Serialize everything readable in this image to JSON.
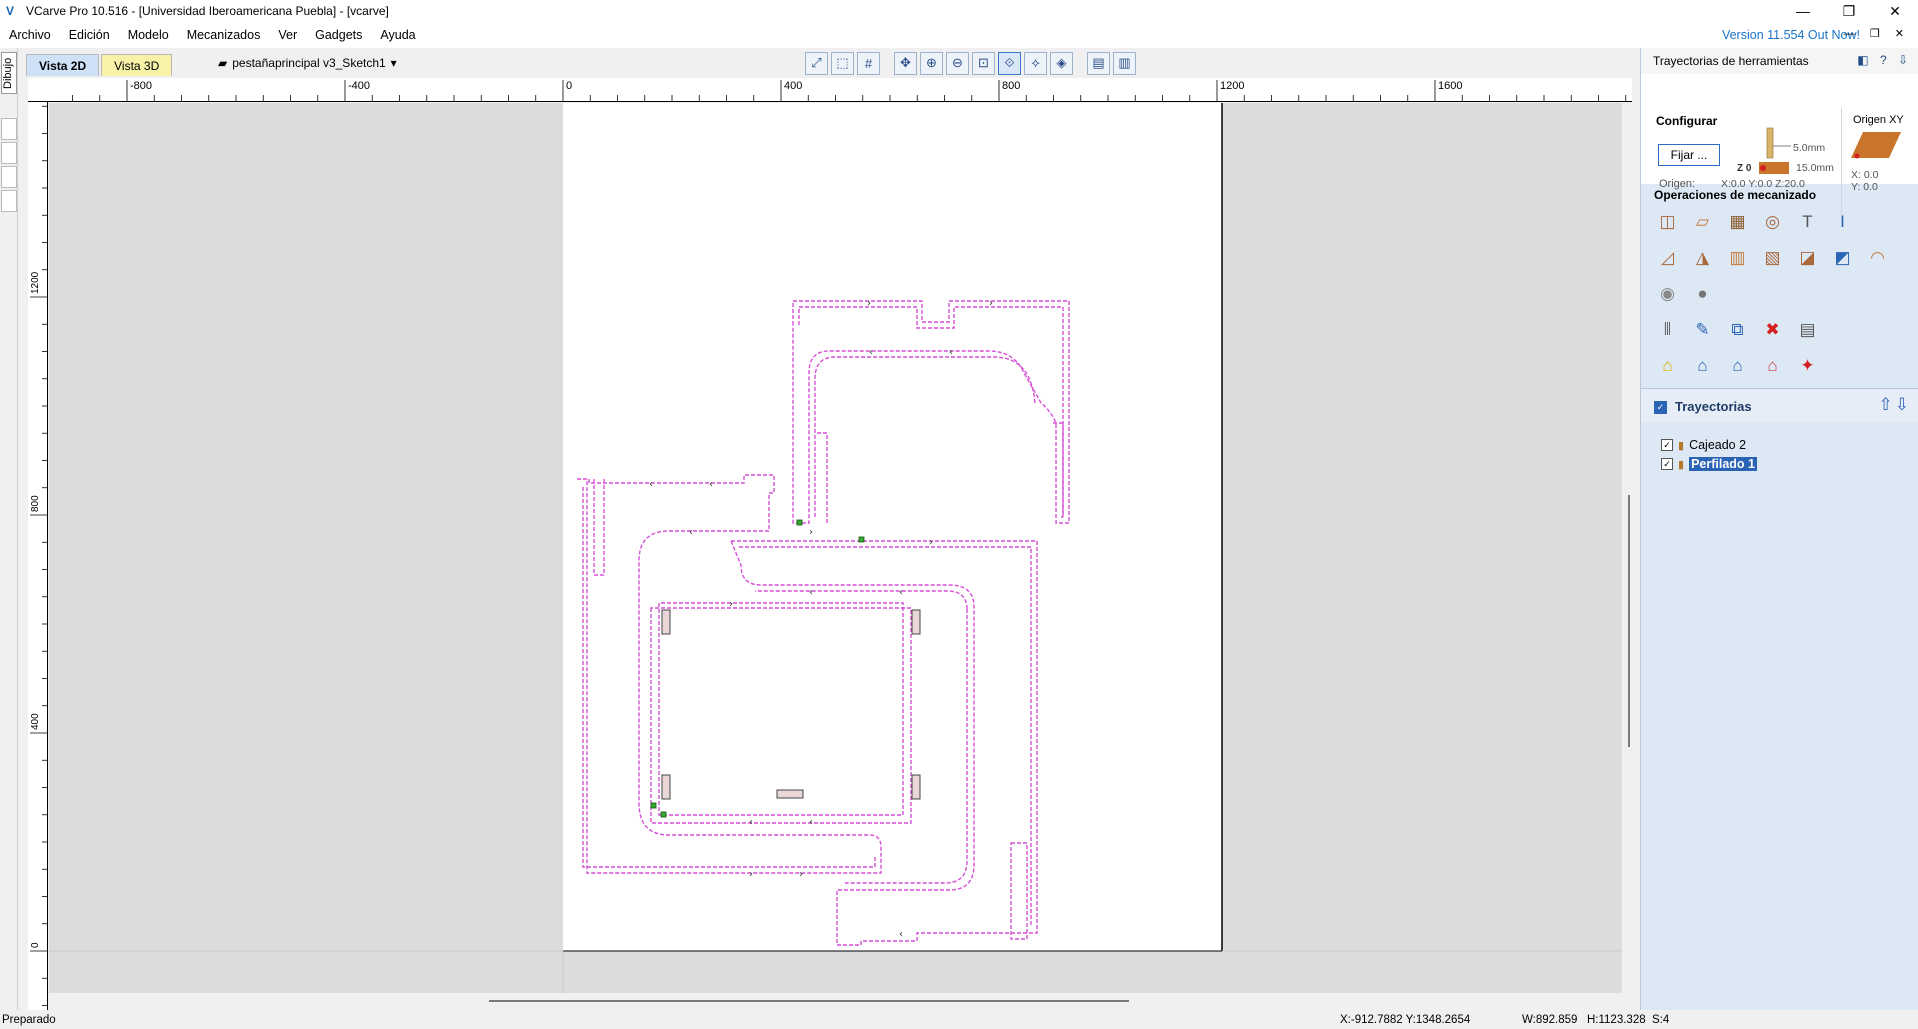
{
  "window": {
    "title": "VCarve Pro 10.516 - [Universidad Iberoamericana Puebla] - [vcarve]",
    "app_icon": "vcarve-logo-icon",
    "controls": [
      "minimize-icon",
      "restore-icon",
      "close-icon"
    ]
  },
  "menu": {
    "items": [
      "Archivo",
      "Edición",
      "Modelo",
      "Mecanizados",
      "Ver",
      "Gadgets",
      "Ayuda"
    ],
    "version_notice": "Version 11.554 Out Now!"
  },
  "left_strip": {
    "dibujo_label": "Dibujo"
  },
  "tabs": {
    "vista2d": "Vista 2D",
    "vista3d": "Vista 3D"
  },
  "layer": {
    "name": "pestañaprincipal v3_Sketch1"
  },
  "toolbar_icons": [
    "zoom-extents-icon",
    "zoom-selected-icon",
    "grid-icon",
    "pan-icon",
    "zoom-in-icon",
    "zoom-out-icon",
    "zoom-box-icon",
    "snap-icon",
    "snap-alt-icon",
    "render-icon",
    "layout-icon",
    "compare-icon"
  ],
  "ruler": {
    "top_labels": [
      "-800",
      "-400",
      "0",
      "400",
      "800",
      "1200",
      "1600"
    ],
    "left_labels": [
      "1200",
      "800",
      "400",
      "0"
    ]
  },
  "status": {
    "left": "Preparado",
    "coords": "X:-912.7882 Y:1348.2654",
    "dims": "W:892.859   H:1123.328  S:4"
  },
  "panel": {
    "title": "Trayectorias de herramientas",
    "configurar": {
      "title": "Configurar",
      "fijar_button": "Fijar ...",
      "origen_label": "Origen:",
      "origen_values": "X:0.0 Y:0.0 Z:20.0",
      "top_thickness": "5.0mm",
      "bottom_thickness": "15.0mm",
      "z_zero": "Z 0"
    },
    "origin_xy": {
      "title": "Origen XY",
      "x": "X: 0.0",
      "y": "Y: 0.0"
    },
    "operations_title": "Operaciones de mecanizado",
    "toolpaths": {
      "title": "Trayectorias",
      "items": [
        {
          "name": "Cajeado 2",
          "checked": true,
          "selected": false
        },
        {
          "name": "Perfilado 1",
          "checked": true,
          "selected": true
        }
      ]
    }
  },
  "colors": {
    "toolpath": "#d64fd6",
    "vector": "#5a5a5a",
    "accent": "#2b63b5"
  }
}
